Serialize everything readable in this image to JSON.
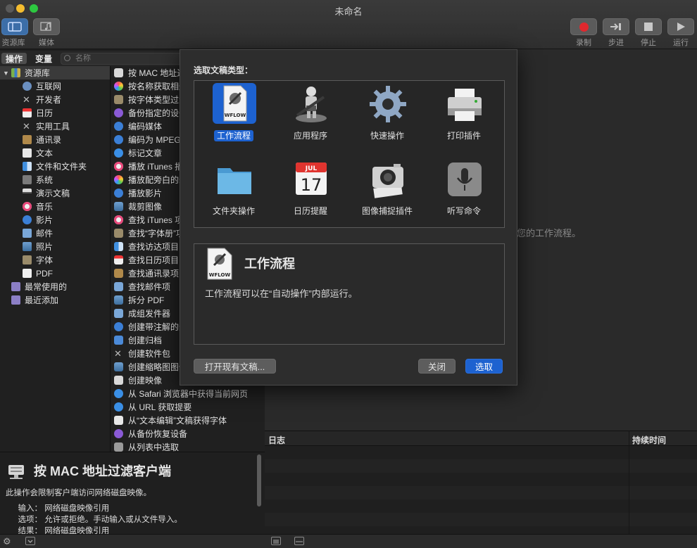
{
  "window": {
    "title": "未命名"
  },
  "toolbar": {
    "library_label": "资源库",
    "media_label": "媒体",
    "record_label": "录制",
    "step_label": "步进",
    "stop_label": "停止",
    "run_label": "运行"
  },
  "tabs": {
    "actions": "操作",
    "variables": "变量"
  },
  "search": {
    "placeholder": "名称"
  },
  "library": {
    "root": "资源库",
    "items": [
      "互联网",
      "开发者",
      "日历",
      "实用工具",
      "通讯录",
      "文本",
      "文件和文件夹",
      "系统",
      "演示文稿",
      "音乐",
      "影片",
      "邮件",
      "照片",
      "字体",
      "PDF"
    ],
    "smart": [
      "最常使用的",
      "最近添加"
    ]
  },
  "actions": [
    "按 MAC 地址过滤客户端",
    "按名称获取相册",
    "按字体类型过滤字体",
    "备份指定的设备",
    "编码媒体",
    "编码为 MPEG 音频",
    "标记文章",
    "播放 iTunes 播放列表",
    "播放配旁白的幻灯片",
    "播放影片",
    "裁剪图像",
    "查找 iTunes 项目",
    "查找“字体册”项目",
    "查找访达项目",
    "查找日历项目",
    "查找通讯录项目",
    "查找邮件项",
    "拆分 PDF",
    "成组发件器",
    "创建带注解的影片",
    "创建归档",
    "创建软件包",
    "创建缩略图图像",
    "创建映像",
    "从 Safari 浏览器中获得当前网页",
    "从 URL 获取提要",
    "从“文本编辑”文稿获得字体",
    "从备份恢复设备",
    "从列表中选取"
  ],
  "description": {
    "title": "按 MAC 地址过滤客户端",
    "text": "此操作会限制客户端访问网络磁盘映像。",
    "input_key": "输入：",
    "input_val": "网络磁盘映像引用",
    "options_key": "选项：",
    "options_val": "允许或拒绝。手动输入或从文件导入。",
    "result_key": "结果：",
    "result_val": "网络磁盘映像引用"
  },
  "canvas": {
    "hint": "您的工作流程。"
  },
  "log": {
    "col_log": "日志",
    "col_duration": "持续时间"
  },
  "sheet": {
    "prompt": "选取文稿类型：",
    "types": [
      "工作流程",
      "应用程序",
      "快速操作",
      "打印插件",
      "文件夹操作",
      "日历提醒",
      "图像捕捉插件",
      "听写命令"
    ],
    "selected_index": 0,
    "info_title": "工作流程",
    "info_text": "工作流程可以在“自动操作”内部运行。",
    "wflow_badge": "WFLOW",
    "cal_month": "JUL",
    "cal_day": "17",
    "open_button": "打开现有文稿...",
    "close_button": "关闭",
    "choose_button": "选取"
  },
  "colors": {
    "accent": "#1d62d0",
    "record": "#e0282e"
  }
}
